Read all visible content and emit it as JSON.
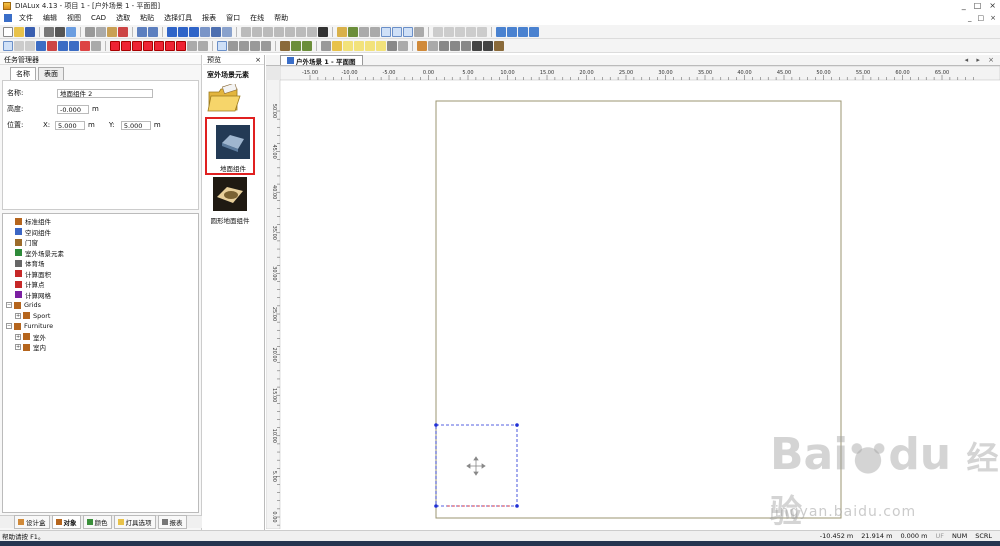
{
  "window": {
    "title": "DIALux 4.13 - 项目 1 - [户外场景 1 - 平面图]",
    "controls": [
      "_",
      "□",
      "×"
    ]
  },
  "menu": [
    "文件",
    "编辑",
    "视图",
    "CAD",
    "选取",
    "粘贴",
    "选择灯具",
    "报表",
    "窗口",
    "在线",
    "帮助"
  ],
  "left_panel": {
    "header": "任务管理器",
    "tabs": [
      "名称",
      "表面"
    ],
    "props": {
      "name_label": "名称:",
      "name_value": "地面组件 2",
      "height_label": "高度:",
      "height_value": "-0.000",
      "height_unit": "m",
      "pos_label": "位置:",
      "x_label": "X:",
      "x_value": "5.000",
      "x_unit": "m",
      "y_label": "Y:",
      "y_value": "5.000",
      "y_unit": "m"
    },
    "tree": [
      {
        "label": "标准组件",
        "indent": 1,
        "exp": "",
        "color": "#b5651d"
      },
      {
        "label": "空间组件",
        "indent": 1,
        "exp": "",
        "color": "#3b66c4"
      },
      {
        "label": "门窗",
        "indent": 1,
        "exp": "",
        "color": "#9c6b2a"
      },
      {
        "label": "室外场景元素",
        "indent": 1,
        "exp": "",
        "color": "#2e8b3a"
      },
      {
        "label": "体育场",
        "indent": 1,
        "exp": "",
        "color": "#666"
      },
      {
        "label": "计算面积",
        "indent": 1,
        "exp": "",
        "color": "#c62828"
      },
      {
        "label": "计算点",
        "indent": 1,
        "exp": "",
        "color": "#c62828"
      },
      {
        "label": "计算网格",
        "indent": 1,
        "exp": "",
        "color": "#7b1fa2"
      },
      {
        "label": "Grids",
        "indent": 0,
        "exp": "−",
        "color": "#b5651d"
      },
      {
        "label": "Sport",
        "indent": 1,
        "exp": "+",
        "color": "#b5651d"
      },
      {
        "label": "Furniture",
        "indent": 0,
        "exp": "−",
        "color": "#b5651d"
      },
      {
        "label": "室外",
        "indent": 1,
        "exp": "+",
        "color": "#b5651d"
      },
      {
        "label": "室内",
        "indent": 1,
        "exp": "+",
        "color": "#b5651d"
      }
    ],
    "bottom_tabs": [
      "设计盒",
      "对象",
      "颜色",
      "灯具选项",
      "报表"
    ]
  },
  "preview": {
    "header": "预览",
    "close": "×",
    "title": "室外场景元素",
    "items": [
      "地面组件",
      "圆形地面组件"
    ]
  },
  "drawing": {
    "tab_label": "户外场景 1 - 平面图",
    "ruler_top": [
      "-15.00",
      "-10.00",
      "-5.00",
      "0.00",
      "5.00",
      "10.00",
      "15.00",
      "20.00",
      "25.00",
      "30.00",
      "35.00",
      "40.00",
      "45.00",
      "50.00",
      "55.00",
      "60.00",
      "65.00"
    ],
    "ruler_left": [
      "50.00",
      "45.00",
      "40.00",
      "35.00",
      "30.00",
      "25.00",
      "20.00",
      "15.00",
      "10.00",
      "5.00",
      "0.00"
    ]
  },
  "status": {
    "help": "帮助请按 F1。",
    "x": "-10.452 m",
    "y": "21.914 m",
    "z": "0.000 m",
    "flags": [
      "UF",
      "NUM",
      "SCRL"
    ]
  },
  "watermark": {
    "brand": "Bai",
    "brand2": "du",
    "cn": "经验",
    "url": "jingyan.baidu.com"
  },
  "colors": {
    "room_outline": "#9b9572",
    "selection": "#1f2fd6",
    "highlight_box": "#e02020"
  }
}
